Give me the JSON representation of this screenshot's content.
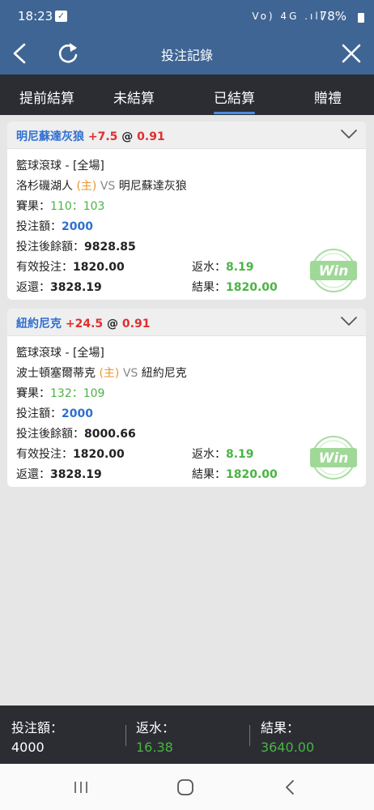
{
  "status": {
    "time": "18:23",
    "battery": "78%",
    "icons_text": "Vo) 4G .ıll"
  },
  "nav": {
    "title": "投注記錄"
  },
  "tabs": [
    "提前結算",
    "未結算",
    "已結算",
    "贈禮"
  ],
  "active_tab": "已結算",
  "cards": [
    {
      "team": "明尼蘇達灰狼",
      "handicap": "+7.5",
      "at": "@",
      "odds": "0.91",
      "league": "籃球滾球 - [全場]",
      "home": "洛杉磯湖人",
      "home_tag": "(主)",
      "vs": "VS",
      "away": "明尼蘇達灰狼",
      "score_label": "賽果：",
      "score": "110：103",
      "stake_label": "投注額：",
      "stake": "2000",
      "balance_label": "投注後餘額：",
      "balance": "9828.85",
      "valid_label": "有效投注：",
      "valid": "1820.00",
      "rebate_label": "返水：",
      "rebate": "8.19",
      "return_label": "返還：",
      "return": "3828.19",
      "result_label": "結果：",
      "result": "1820.00",
      "badge": "Win"
    },
    {
      "team": "紐約尼克",
      "handicap": "+24.5",
      "at": "@",
      "odds": "0.91",
      "league": "籃球滾球 - [全場]",
      "home": "波士頓塞爾蒂克",
      "home_tag": "(主)",
      "vs": "VS",
      "away": "紐約尼克",
      "score_label": "賽果：",
      "score": "132：109",
      "stake_label": "投注額：",
      "stake": "2000",
      "balance_label": "投注後餘額：",
      "balance": "8000.66",
      "valid_label": "有效投注：",
      "valid": "1820.00",
      "rebate_label": "返水：",
      "rebate": "8.19",
      "return_label": "返還：",
      "return": "3828.19",
      "result_label": "結果：",
      "result": "1820.00",
      "badge": "Win"
    }
  ],
  "footer": {
    "stake_label": "投注額：",
    "stake": "4000",
    "rebate_label": "返水：",
    "rebate": "16.38",
    "result_label": "結果：",
    "result": "3640.00"
  },
  "colors": {
    "header": "#3f6594",
    "tabbar": "#2b2d33",
    "accent_blue": "#2f6fd0",
    "red": "#e02f2f",
    "green": "#4bb443",
    "orange": "#e9962a"
  }
}
